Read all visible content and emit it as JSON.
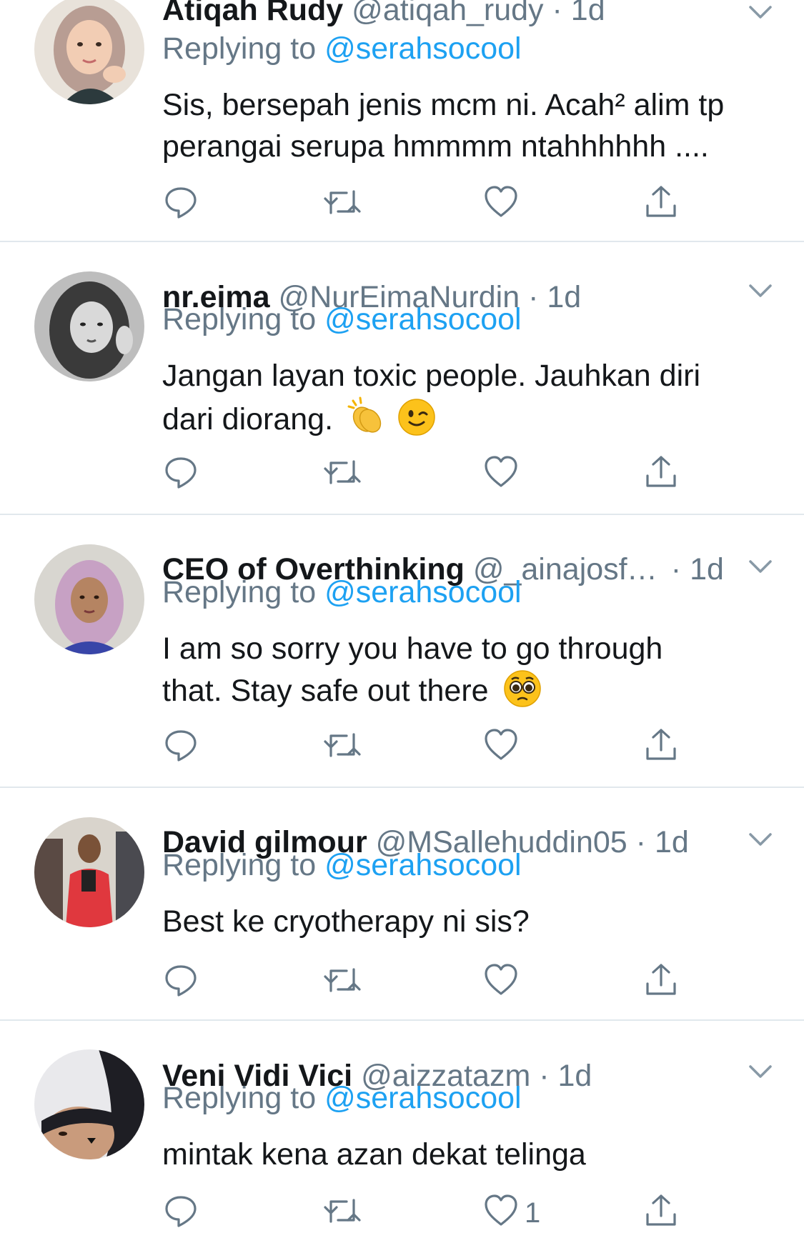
{
  "tweets": [
    {
      "name": "Atiqah Rudy",
      "handle": "@atiqah_rudy",
      "separator": "·",
      "time": "1d",
      "replying_label": "Replying to",
      "replying_to": "@serahsocool",
      "text_lines": [
        "Sis, bersepah jenis mcm ni. Acah² alim tp",
        "perangai serupa  hmmmm ntahhhhhh ...."
      ],
      "emojis": [],
      "like_count": ""
    },
    {
      "name": "nr.eima",
      "handle": "@NurEimaNurdin",
      "separator": "·",
      "time": "1d",
      "replying_label": "Replying to",
      "replying_to": "@serahsocool",
      "text_lines": [
        "Jangan layan toxic people. Jauhkan diri",
        "dari diorang."
      ],
      "emojis": [
        "clapping-hands-emoji",
        "winking-face-emoji"
      ],
      "like_count": ""
    },
    {
      "name": "CEO of Overthinking",
      "handle": "@_ainajosffiyah",
      "separator": "·",
      "time": "1d",
      "replying_label": "Replying to",
      "replying_to": "@serahsocool",
      "text_lines": [
        "I am so sorry you have to go through",
        "that. Stay safe out there"
      ],
      "emojis": [
        "pleading-face-emoji"
      ],
      "like_count": ""
    },
    {
      "name": "David gilmour",
      "handle": "@MSallehuddin05",
      "separator": "·",
      "time": "1d",
      "replying_label": "Replying to",
      "replying_to": "@serahsocool",
      "text_lines": [
        "Best ke cryotherapy ni sis?"
      ],
      "emojis": [],
      "like_count": ""
    },
    {
      "name": "Veni Vidi Vici",
      "handle": "@aizzatazm",
      "separator": "·",
      "time": "1d",
      "replying_label": "Replying to",
      "replying_to": "@serahsocool",
      "text_lines": [
        "mintak kena azan dekat telinga"
      ],
      "emojis": [],
      "like_count": "1"
    }
  ],
  "icons": {
    "reply": "reply-icon",
    "retweet": "retweet-icon",
    "like": "heart-icon",
    "share": "share-icon",
    "more": "chevron-down-icon"
  },
  "colors": {
    "link": "#1da1f2",
    "secondary_text": "#657786",
    "primary_text": "#14171a",
    "divider": "#e1e8ed"
  }
}
